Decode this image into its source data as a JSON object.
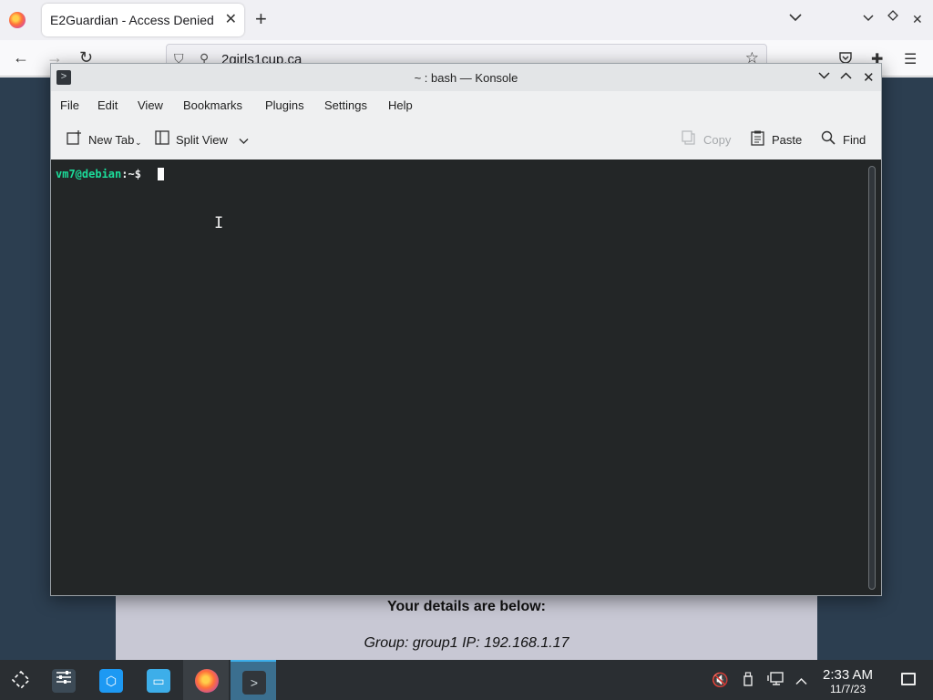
{
  "browser": {
    "tab_title": "E2Guardian - Access Denied",
    "url": "2girls1cup.ca",
    "page": {
      "details_heading": "Your details are below:",
      "group_line": "Group: group1   IP: 192.168.1.17"
    }
  },
  "konsole": {
    "title": "~ : bash — Konsole",
    "menu": [
      "File",
      "Edit",
      "View",
      "Bookmarks",
      "Plugins",
      "Settings",
      "Help"
    ],
    "toolbar": {
      "new_tab": "New Tab",
      "split_view": "Split View",
      "copy": "Copy",
      "paste": "Paste",
      "find": "Find"
    },
    "terminal": {
      "prompt_user": "vm7@debian",
      "prompt_path": ":~$"
    }
  },
  "taskbar": {
    "clock_time": "2:33 AM",
    "clock_date": "11/7/23"
  },
  "colors": {
    "terminal_bg": "#232627",
    "prompt_green": "#1cdc9a",
    "taskbar_bg": "#2a2e32",
    "active_task": "#3b6f8f"
  }
}
